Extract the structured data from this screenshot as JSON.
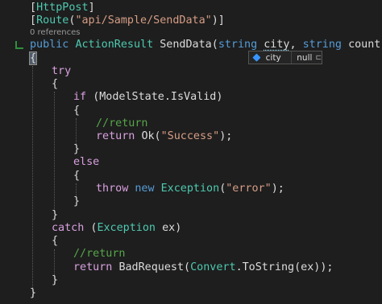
{
  "codelens": "0 references",
  "lines": {
    "l1": {
      "attr": "HttpPost"
    },
    "l2": {
      "attr": "Route",
      "arg": "\"api/Sample/SendData\""
    },
    "l3": {
      "mod": "public",
      "ret": "ActionResult",
      "name": "SendData",
      "t1": "string",
      "p1": "city",
      "t2": "string",
      "p2": "country"
    },
    "l5": {
      "kw": "try"
    },
    "l7": {
      "kw": "if",
      "cond": "(ModelState.IsValid)"
    },
    "l9": {
      "comment": "//return"
    },
    "l10": {
      "kw": "return",
      "call": "Ok(",
      "arg": "\"Success\"",
      "end": ");"
    },
    "l12": {
      "kw": "else"
    },
    "l14": {
      "kw": "throw",
      "kw2": "new",
      "type": "Exception",
      "arg": "\"error\"",
      "end": ");"
    },
    "l16": {
      "kw": "catch",
      "type": "Exception",
      "var": "ex"
    },
    "l18": {
      "comment": "//return"
    },
    "l19": {
      "kw": "return",
      "call": "BadRequest(",
      "type": "Convert",
      "method": ".ToString(ex));"
    }
  },
  "datatip": {
    "name": "city",
    "value": "null",
    "icon": "field-icon",
    "pin": "pin-icon"
  },
  "colors": {
    "background": "#1e1e1e",
    "keyword": "#569cd6",
    "control": "#d8a0df",
    "type": "#4ec9b0",
    "string": "#d69d85",
    "comment": "#57a64a"
  }
}
